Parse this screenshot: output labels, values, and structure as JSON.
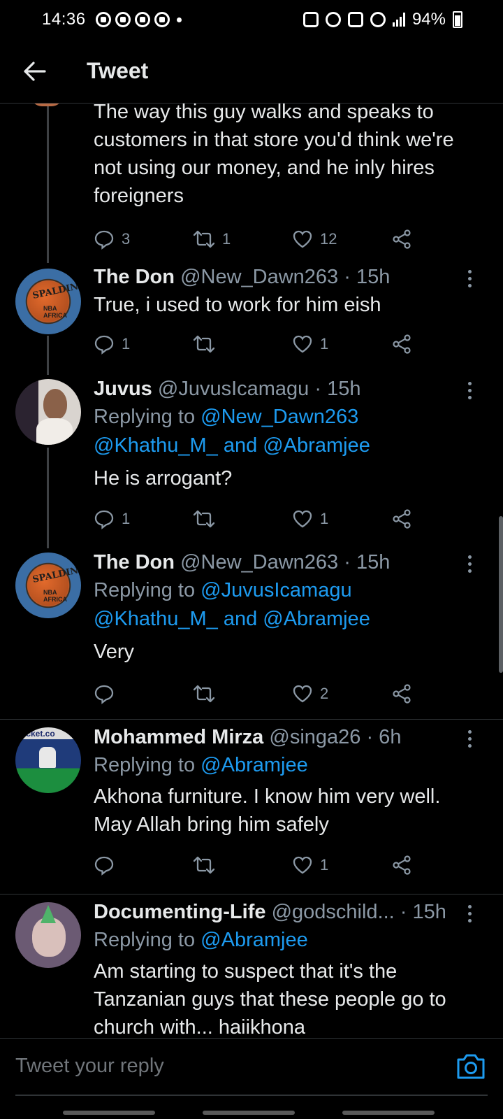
{
  "status_bar": {
    "time": "14:36",
    "battery": "94%"
  },
  "header": {
    "title": "Tweet"
  },
  "tweets": [
    {
      "body": "The way this guy walks and speaks to customers in that store you'd think we're not using our money, and he inly hires foreigners",
      "replies": "3",
      "retweets": "1",
      "likes": "12"
    },
    {
      "name": "The Don",
      "handle": "@New_Dawn263 · 15h",
      "body": "True, i used to work for him eish",
      "replies": "1",
      "retweets": "",
      "likes": "1",
      "avatar": "spalding-basketball"
    },
    {
      "name": "Juvus",
      "handle": "@JuvusIcamagu · 15h",
      "replying_prefix": "Replying to",
      "replying_mentions": "@New_Dawn263 @Khathu_M_ and @Abramjee",
      "body": "He is arrogant?",
      "replies": "1",
      "retweets": "",
      "likes": "1",
      "avatar": "person-photo"
    },
    {
      "name": "The Don",
      "handle": "@New_Dawn263 · 15h",
      "replying_prefix": "Replying to",
      "replying_mentions": "@JuvusIcamagu @Khathu_M_ and @Abramjee",
      "body": "Very",
      "replies": "",
      "retweets": "",
      "likes": "2",
      "avatar": "spalding-basketball"
    },
    {
      "name": "Mohammed Mirza",
      "handle": "@singa26 · 6h",
      "replying_prefix": "Replying to",
      "replying_mentions": "@Abramjee",
      "body": "Akhona furniture. I know him very well. May Allah bring him safely",
      "replies": "",
      "retweets": "",
      "likes": "1",
      "avatar": "ticket-photo"
    },
    {
      "name": "Documenting-Life",
      "handle": "@godschild...",
      "time": "· 15h",
      "replying_prefix": "Replying to",
      "replying_mentions": "@Abramjee",
      "body": "Am starting to suspect that it's the Tanzanian guys that these people go to church with... haiikhona",
      "avatar": "ape-nft"
    }
  ],
  "reply_bar": {
    "placeholder": "Tweet your reply"
  },
  "colors": {
    "background": "#000000",
    "text": "#e7e9ea",
    "muted": "#8b98a5",
    "accent": "#1d9bf0",
    "divider": "#2f3336"
  }
}
